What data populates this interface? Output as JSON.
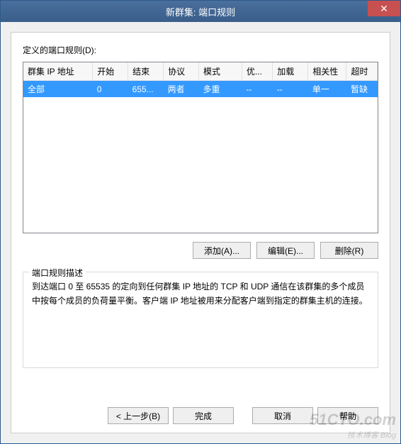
{
  "title": "新群集: 端口规则",
  "labels": {
    "define": "定义的端口规则(D):",
    "group_title": "端口规则描述"
  },
  "columns": {
    "cluster_ip": "群集 IP 地址",
    "start": "开始",
    "end": "结束",
    "protocol": "协议",
    "mode": "模式",
    "priority": "优...",
    "load": "加载",
    "affinity": "相关性",
    "timeout": "超时"
  },
  "rows": [
    {
      "cluster_ip": "全部",
      "start": "0",
      "end": "655...",
      "protocol": "两者",
      "mode": "多重",
      "priority": "--",
      "load": "--",
      "affinity": "单一",
      "timeout": "暂缺"
    }
  ],
  "buttons": {
    "add": "添加(A)...",
    "edit": "编辑(E)...",
    "remove": "删除(R)",
    "back": "< 上一步(B)",
    "finish": "完成",
    "cancel": "取消",
    "help": "帮助"
  },
  "description": "到达端口 0 至 65535 的定向到任何群集 IP 地址的 TCP 和 UDP 通信在该群集的多个成员中按每个成员的负荷量平衡。客户端 IP 地址被用来分配客户端到指定的群集主机的连接。",
  "watermark": {
    "main": "51CTO.com",
    "sub": "技术博客 Blog"
  }
}
